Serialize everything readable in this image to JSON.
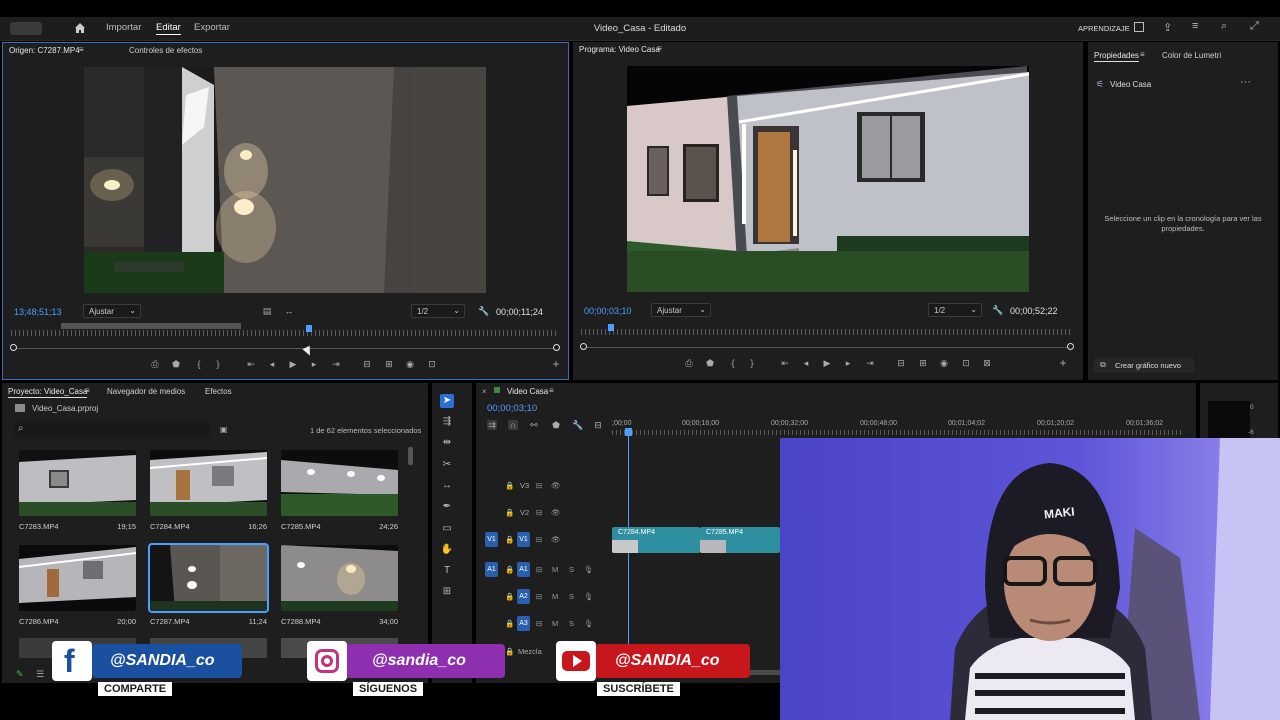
{
  "topbar": {
    "menu": [
      "Importar",
      "Editar",
      "Exportar"
    ],
    "active_menu": "Editar",
    "title": "Video_Casa - Editado",
    "learn_label": "APRENDIZAJE"
  },
  "source_monitor": {
    "tab_source": "Origen: C7287.MP4",
    "tab_effects": "Controles de efectos",
    "timecode_in": "13;48;51;13",
    "fit_label": "Ajustar",
    "res_label": "1/2",
    "duration": "00;00;11;24"
  },
  "program_monitor": {
    "tab": "Programa: Video Casa",
    "timecode_in": "00;00;03;10",
    "fit_label": "Ajustar",
    "res_label": "1/2",
    "duration": "00;00;52;22"
  },
  "properties": {
    "tab_props": "Propiedades",
    "tab_lumetri": "Color de Lumetri",
    "sequence_name": "Video Casa",
    "empty_message": "Seleccione un clip en la cronología para ver las propiedades.",
    "new_graphic_button": "Crear gráfico nuevo"
  },
  "project": {
    "tab_project": "Proyecto: Video_Casa",
    "tab_media": "Navegador de medios",
    "tab_effects": "Efectos",
    "file_name": "Video_Casa.prproj",
    "selection_count": "1 de 62 elementos seleccionados",
    "items": [
      {
        "name": "C7283.MP4",
        "duration": "19;15"
      },
      {
        "name": "C7284.MP4",
        "duration": "16;26"
      },
      {
        "name": "C7285.MP4",
        "duration": "24;26"
      },
      {
        "name": "C7286.MP4",
        "duration": "20;00"
      },
      {
        "name": "C7287.MP4",
        "duration": "11;24"
      },
      {
        "name": "C7288.MP4",
        "duration": "34;00"
      }
    ]
  },
  "timeline": {
    "tab": "Video Casa",
    "playhead": "00;00;03;10",
    "ruler": [
      ";00;00",
      "00;00;16;00",
      "00;00;32;00",
      "00;00;48;00",
      "00;01;04;02",
      "00;01;20;02",
      "00;01;36;02"
    ],
    "tracks_video": [
      "V3",
      "V2",
      "V1"
    ],
    "tracks_audio": [
      "A1",
      "A2",
      "A3"
    ],
    "mix_label": "Mezcla",
    "clips": [
      "C7284.MP4",
      "C7285.MP4"
    ],
    "meter_labels": [
      "0",
      "-6"
    ]
  },
  "webcam": {
    "cap_text": "MAKI"
  },
  "overlay": {
    "facebook": {
      "handle": "@SANDIA_co",
      "cta": "COMPARTE"
    },
    "instagram": {
      "handle": "@sandia_co",
      "cta": "SÍGUENOS"
    },
    "youtube": {
      "handle": "@SANDIA_co",
      "cta": "SUSCRÍBETE"
    }
  },
  "colors": {
    "accent_blue": "#4d9fff",
    "clip_teal": "#2e8fa0",
    "facebook_blue": "#1b4fa0",
    "instagram_purple": "#8e2fb0",
    "youtube_red": "#c8161d"
  }
}
